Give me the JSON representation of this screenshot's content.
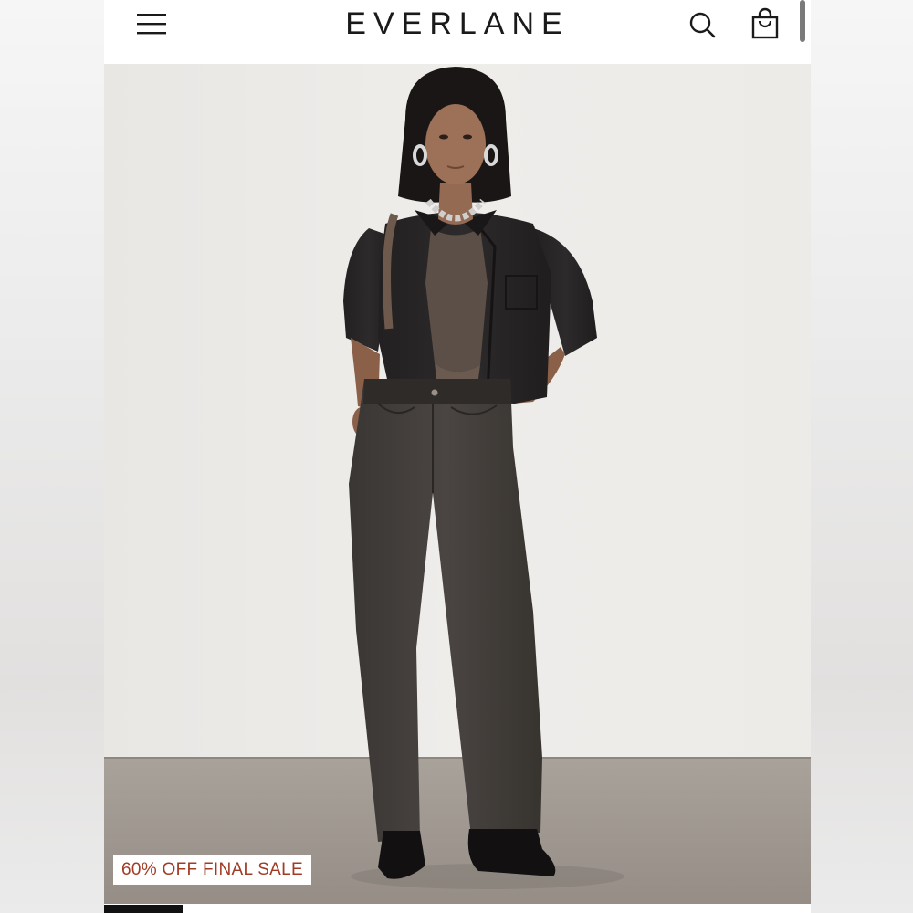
{
  "header": {
    "logo": "EVERLANE",
    "menu_icon": "hamburger-menu-icon",
    "search_icon": "search-icon",
    "bag_icon": "shopping-bag-icon"
  },
  "hero": {
    "badge": "60% OFF FINAL SALE"
  },
  "carousel": {
    "active_index": 1
  },
  "colors": {
    "badge_text": "#a23b26",
    "logo": "#1a1a1a"
  }
}
